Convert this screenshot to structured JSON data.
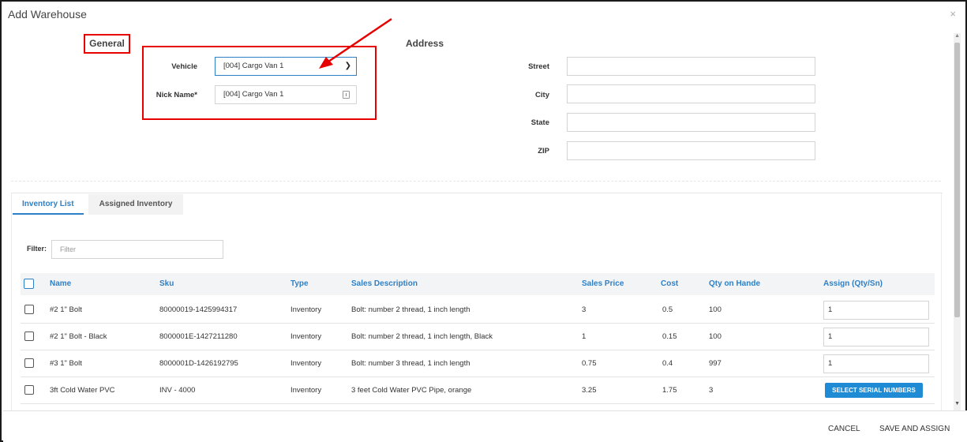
{
  "dialog": {
    "title": "Add Warehouse",
    "close_glyph": "×"
  },
  "general": {
    "heading": "General",
    "vehicle_label": "Vehicle",
    "vehicle_value": "[004] Cargo Van 1",
    "nickname_label": "Nick Name*",
    "nickname_value": "[004] Cargo Van 1"
  },
  "address": {
    "heading": "Address",
    "street_label": "Street",
    "street_value": "",
    "city_label": "City",
    "city_value": "",
    "state_label": "State",
    "state_value": "",
    "zip_label": "ZIP",
    "zip_value": ""
  },
  "tabs": [
    {
      "label": "Inventory List",
      "active": true
    },
    {
      "label": "Assigned Inventory",
      "active": false
    }
  ],
  "filter": {
    "label": "Filter:",
    "placeholder": "Filter"
  },
  "table": {
    "columns": [
      "Name",
      "Sku",
      "Type",
      "Sales Description",
      "Sales Price",
      "Cost",
      "Qty on Hande",
      "Assign (Qty/Sn)"
    ],
    "rows": [
      {
        "name": "#2 1\" Bolt",
        "sku": "80000019-1425994317",
        "type": "Inventory",
        "desc": "Bolt: number 2 thread, 1 inch length",
        "price": "3",
        "cost": "0.5",
        "qty": "100",
        "assign": "1"
      },
      {
        "name": "#2 1\" Bolt - Black",
        "sku": "8000001E-1427211280",
        "type": "Inventory",
        "desc": "Bolt: number 2 thread, 1 inch length, Black",
        "price": "1",
        "cost": "0.15",
        "qty": "100",
        "assign": "1"
      },
      {
        "name": "#3 1\" Bolt",
        "sku": "8000001D-1426192795",
        "type": "Inventory",
        "desc": "Bolt: number 3 thread, 1 inch length",
        "price": "0.75",
        "cost": "0.4",
        "qty": "997",
        "assign": "1"
      },
      {
        "name": "3ft Cold Water PVC",
        "sku": "INV - 4000",
        "type": "Inventory",
        "desc": "3 feet Cold Water PVC Pipe, orange",
        "price": "3.25",
        "cost": "1.75",
        "qty": "3",
        "assign_button": "SELECT SERIAL NUMBERS"
      }
    ]
  },
  "footer": {
    "cancel": "CANCEL",
    "save": "SAVE AND ASSIGN"
  },
  "colors": {
    "accent": "#2e80c6",
    "highlight": "#e60000",
    "button": "#1f8bd4"
  },
  "icons": [
    "close-icon",
    "chevron-down-icon",
    "input-keyboard-icon",
    "annotation-arrow",
    "scroll-up-icon",
    "scroll-down-icon"
  ]
}
